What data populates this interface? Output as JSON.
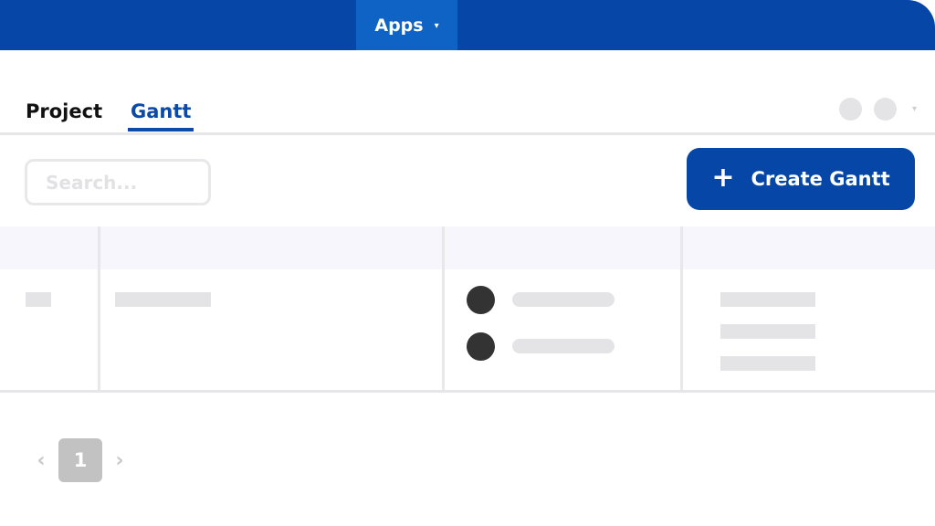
{
  "topbar": {
    "apps_label": "Apps",
    "apps_caret": "▾",
    "color": "#0646a6",
    "apps_active_color": "#0e63c4"
  },
  "tabs": [
    {
      "label": "Project",
      "active": false
    },
    {
      "label": "Gantt",
      "active": true
    }
  ],
  "header_right": {
    "avatars": [
      "avatar-placeholder",
      "avatar-placeholder"
    ],
    "caret": "▾"
  },
  "search": {
    "placeholder": "Search...",
    "value": ""
  },
  "create_button": {
    "icon": "plus-icon",
    "icon_glyph": "+",
    "label": "Create Gantt"
  },
  "table": {
    "columns": [
      "",
      "",
      "",
      ""
    ],
    "rows": [
      {
        "cells": [
          "placeholder",
          "placeholder",
          "assignees-placeholder",
          "lines-placeholder"
        ]
      }
    ]
  },
  "pagination": {
    "prev_glyph": "‹",
    "next_glyph": "›",
    "current_page": "1"
  }
}
